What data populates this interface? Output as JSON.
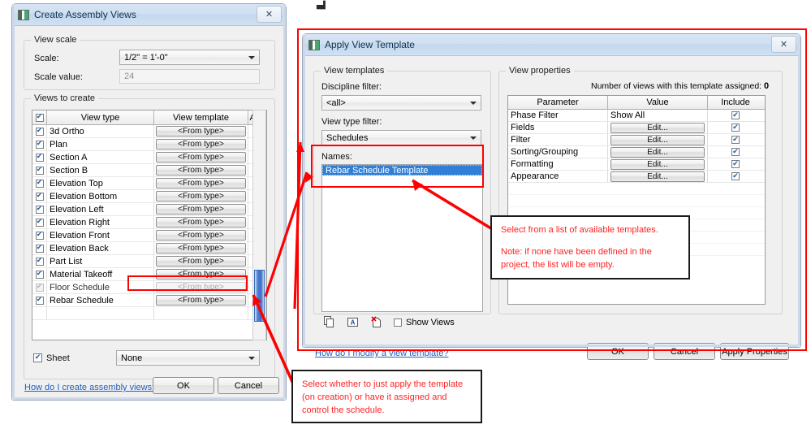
{
  "accent": {
    "annotation_red": "#ff0000",
    "selection_blue": "#2f7fd8",
    "link_blue": "#1f5fbf"
  },
  "left_dialog": {
    "title": "Create Assembly Views",
    "close_label": "✕",
    "view_scale_group": {
      "label": "View scale",
      "scale_label": "Scale:",
      "scale_value": "1/2\" = 1'-0\"",
      "scale_value_label": "Scale value:",
      "scale_value_field": "24"
    },
    "views_group": {
      "label": "Views to create",
      "columns": [
        "View type",
        "View template",
        "Assign"
      ],
      "rows": [
        {
          "checked": true,
          "type": "3d Ortho",
          "template": "<From type>",
          "assign": false,
          "enabled": true
        },
        {
          "checked": true,
          "type": "Plan",
          "template": "<From type>",
          "assign": false,
          "enabled": true
        },
        {
          "checked": true,
          "type": "Section A",
          "template": "<From type>",
          "assign": false,
          "enabled": true
        },
        {
          "checked": true,
          "type": "Section B",
          "template": "<From type>",
          "assign": false,
          "enabled": true
        },
        {
          "checked": true,
          "type": "Elevation Top",
          "template": "<From type>",
          "assign": false,
          "enabled": true
        },
        {
          "checked": true,
          "type": "Elevation Bottom",
          "template": "<From type>",
          "assign": false,
          "enabled": true
        },
        {
          "checked": true,
          "type": "Elevation Left",
          "template": "<From type>",
          "assign": false,
          "enabled": true
        },
        {
          "checked": true,
          "type": "Elevation Right",
          "template": "<From type>",
          "assign": false,
          "enabled": true
        },
        {
          "checked": true,
          "type": "Elevation Front",
          "template": "<From type>",
          "assign": false,
          "enabled": true
        },
        {
          "checked": true,
          "type": "Elevation Back",
          "template": "<From type>",
          "assign": false,
          "enabled": true
        },
        {
          "checked": true,
          "type": "Part List",
          "template": "<From type>",
          "assign": false,
          "enabled": true
        },
        {
          "checked": true,
          "type": "Material Takeoff",
          "template": "<From type>",
          "assign": false,
          "enabled": true
        },
        {
          "checked": false,
          "type": "Floor Schedule",
          "template": "<From type>",
          "assign": true,
          "enabled": false
        },
        {
          "checked": true,
          "type": "Rebar Schedule",
          "template": "<From type>",
          "assign": true,
          "enabled": true
        }
      ]
    },
    "sheet": {
      "checked": true,
      "label": "Sheet",
      "value": "None"
    },
    "help_link": "How do I create assembly views?",
    "ok_label": "OK",
    "cancel_label": "Cancel"
  },
  "right_dialog": {
    "title": "Apply View Template",
    "close_label": "✕",
    "view_templates_group": {
      "label": "View templates",
      "discipline_filter_label": "Discipline filter:",
      "discipline_filter_value": "<all>",
      "view_type_filter_label": "View type filter:",
      "view_type_filter_value": "Schedules",
      "names_label": "Names:",
      "names_items": [
        "Rebar Schedule Template"
      ],
      "icons": [
        "duplicate-icon",
        "rename-icon",
        "delete-icon"
      ],
      "show_views_label": "Show Views",
      "show_views_checked": false
    },
    "view_properties_group": {
      "label": "View properties",
      "count_text": "Number of views with this template assigned:",
      "count_value": "0",
      "columns": [
        "Parameter",
        "Value",
        "Include"
      ],
      "rows": [
        {
          "parameter": "Phase Filter",
          "value": "Show All",
          "is_button": false,
          "include": true
        },
        {
          "parameter": "Fields",
          "value": "Edit...",
          "is_button": true,
          "include": true
        },
        {
          "parameter": "Filter",
          "value": "Edit...",
          "is_button": true,
          "include": true
        },
        {
          "parameter": "Sorting/Grouping",
          "value": "Edit...",
          "is_button": true,
          "include": true
        },
        {
          "parameter": "Formatting",
          "value": "Edit...",
          "is_button": true,
          "include": true
        },
        {
          "parameter": "Appearance",
          "value": "Edit...",
          "is_button": true,
          "include": true
        }
      ]
    },
    "help_link": "How do I modify a view template?",
    "ok_label": "OK",
    "cancel_label": "Cancel",
    "apply_label": "Apply Properties"
  },
  "annotations": {
    "templates_note": {
      "line1": "Select from a list of available templates.",
      "line2": "Note: if none have been defined in the project, the list will be empty."
    },
    "assign_note": {
      "line1": "Select whether to just apply the template (on creation) or have it assigned and control the schedule."
    }
  }
}
